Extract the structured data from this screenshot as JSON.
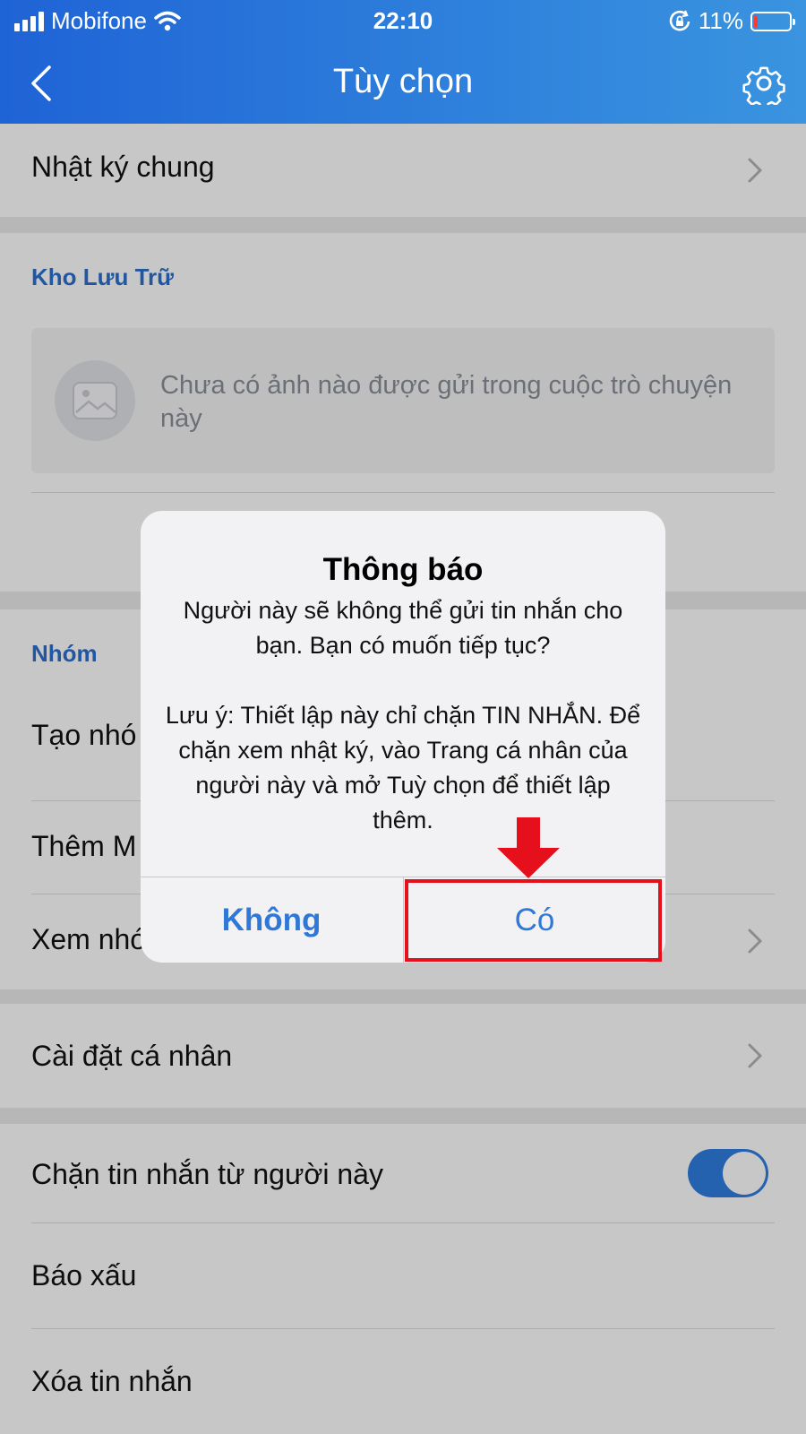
{
  "status_bar": {
    "carrier": "Mobifone",
    "time": "22:10",
    "battery": "11%",
    "battery_level": 0.11
  },
  "header": {
    "title": "Tùy chọn"
  },
  "rows": {
    "nhat_ky_chung": "Nhật ký chung",
    "storage_section": "Kho Lưu Trữ",
    "storage_empty": "Chưa có ảnh nào được gửi trong cuộc trò chuyện này",
    "group_section": "Nhóm",
    "tao_nhom": "Tạo nhó",
    "them_m": "Thêm M",
    "xem_nho": "Xem nhó",
    "cai_dat": "Cài đặt cá nhân",
    "chan_tin": "Chặn tin nhắn từ người này",
    "bao_xau": "Báo xấu",
    "xoa_tin": "Xóa tin nhắn"
  },
  "block_toggle": {
    "on": true
  },
  "alert": {
    "title": "Thông báo",
    "message": "Người này sẽ không thể gửi tin nhắn cho bạn. Bạn có muốn tiếp tục?",
    "note": "Lưu ý: Thiết lập này chỉ chặn TIN NHẮN. Để chặn xem nhật ký, vào Trang cá nhân của người này và mở Tuỳ chọn để thiết lập thêm.",
    "no_label": "Không",
    "yes_label": "Có"
  },
  "colors": {
    "header": "#2a74d8",
    "accent": "#2f78d8",
    "annotation": "#e5101c",
    "toggle": "#2f7de0"
  },
  "icons": [
    "back-arrow-icon",
    "gear-icon",
    "chevron-right-icon",
    "image-icon",
    "wifi-icon",
    "rotation-lock-icon",
    "battery-icon",
    "signal-icon"
  ]
}
